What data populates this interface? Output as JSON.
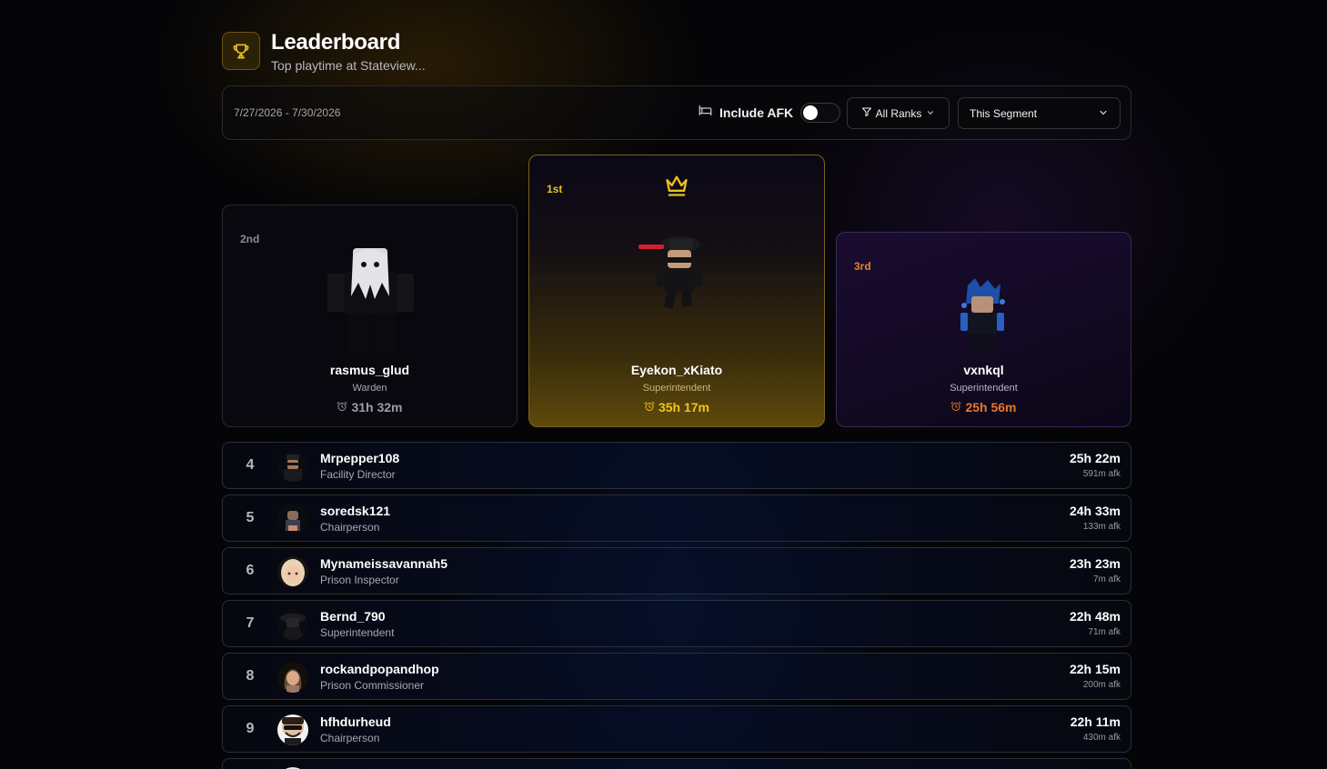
{
  "header": {
    "title": "Leaderboard",
    "subtitle": "Top playtime at Stateview...",
    "icon": "trophy-icon",
    "accent": "#e9c21b"
  },
  "filters": {
    "date_range": "7/27/2026 - 7/30/2026",
    "afk_label": "Include AFK",
    "afk_enabled": false,
    "ranks_label": "All Ranks",
    "segment_label": "This Segment"
  },
  "podium": [
    {
      "place": "1st",
      "name": "Eyekon_xKiato",
      "rank": "Superintendent",
      "time": "35h 17m",
      "color": "#f0c419"
    },
    {
      "place": "2nd",
      "name": "rasmus_glud",
      "rank": "Warden",
      "time": "31h 32m",
      "color": "#9c9ca4"
    },
    {
      "place": "3rd",
      "name": "vxnkql",
      "rank": "Superintendent",
      "time": "25h 56m",
      "color": "#e8772b"
    }
  ],
  "rows": [
    {
      "num": "4",
      "name": "Mrpepper108",
      "rank": "Facility Director",
      "time": "25h 22m",
      "afk": "591m afk"
    },
    {
      "num": "5",
      "name": "soredsk121",
      "rank": "Chairperson",
      "time": "24h 33m",
      "afk": "133m afk"
    },
    {
      "num": "6",
      "name": "Mynameissavannah5",
      "rank": "Prison Inspector",
      "time": "23h 23m",
      "afk": "7m afk"
    },
    {
      "num": "7",
      "name": "Bernd_790",
      "rank": "Superintendent",
      "time": "22h 48m",
      "afk": "71m afk"
    },
    {
      "num": "8",
      "name": "rockandpopandhop",
      "rank": "Prison Commissioner",
      "time": "22h 15m",
      "afk": "200m afk"
    },
    {
      "num": "9",
      "name": "hfhdurheud",
      "rank": "Chairperson",
      "time": "22h 11m",
      "afk": "430m afk"
    }
  ]
}
